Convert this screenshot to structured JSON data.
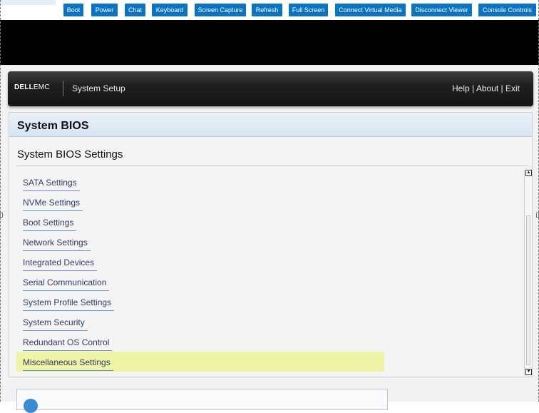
{
  "toolbar": {
    "buttons": [
      {
        "label": "Boot"
      },
      {
        "label": "Power"
      },
      {
        "label": "Chat"
      },
      {
        "label": "Keyboard"
      },
      {
        "label": "Screen Capture"
      },
      {
        "label": "Refresh"
      },
      {
        "label": "Full Screen"
      },
      {
        "label": "Connect Virtual Media"
      },
      {
        "label": "Disconnect Viewer"
      },
      {
        "label": "Console Controls"
      }
    ],
    "button_color": "#0a73c2"
  },
  "header": {
    "logo_dell": "DELL",
    "logo_emc": "EMC",
    "title": "System Setup",
    "help": "Help",
    "about": "About",
    "exit": "Exit",
    "separator": "|"
  },
  "panel": {
    "title": "System BIOS",
    "section_title": "System BIOS Settings",
    "items": [
      {
        "label": "SATA Settings"
      },
      {
        "label": "NVMe Settings"
      },
      {
        "label": "Boot Settings"
      },
      {
        "label": "Network Settings"
      },
      {
        "label": "Integrated Devices"
      },
      {
        "label": "Serial Communication"
      },
      {
        "label": "System Profile Settings"
      },
      {
        "label": "System Security"
      },
      {
        "label": "Redundant OS Control"
      },
      {
        "label": "Miscellaneous Settings",
        "selected": true
      }
    ],
    "selected_color": "#eef3a6"
  },
  "icons": {
    "info": "info-icon",
    "scroll_up": "scroll-up-arrow-icon",
    "scroll_down": "scroll-down-arrow-icon"
  }
}
